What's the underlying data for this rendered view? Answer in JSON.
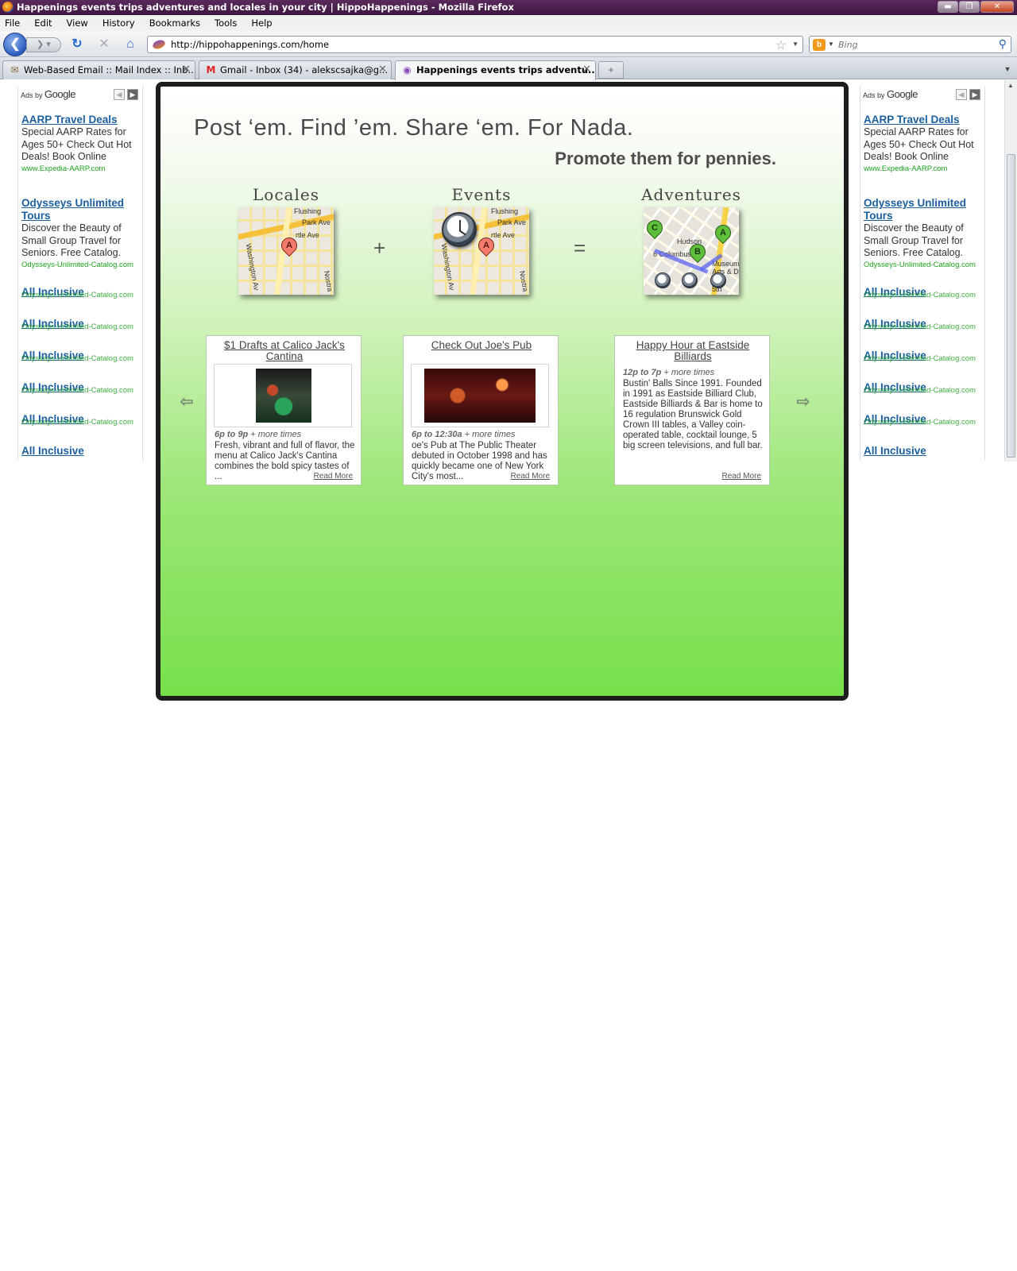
{
  "window": {
    "title": "Happenings events trips adventures and locales in your city | HippoHappenings - Mozilla Firefox",
    "minimize_label": "▬",
    "maximize_label": "❐",
    "close_label": "✕"
  },
  "menu": [
    "File",
    "Edit",
    "View",
    "History",
    "Bookmarks",
    "Tools",
    "Help"
  ],
  "navbar": {
    "back_label": "❮",
    "forward_label": "❯ ▾",
    "reload_label": "↻",
    "stop_label": "✕",
    "home_label": "⌂",
    "url": "http://hippohappenings.com/home",
    "search_placeholder": "Bing",
    "engine_label": "b"
  },
  "tabs": [
    {
      "label": "Web-Based Email :: Mail Index :: Inb...",
      "icon": "mail-client-icon",
      "active": false
    },
    {
      "label": "Gmail - Inbox (34) - alekscsajka@g...",
      "icon": "gmail-icon",
      "active": false
    },
    {
      "label": "Happenings events trips adventu...",
      "icon": "hippo-icon",
      "active": true
    }
  ],
  "ads": {
    "header_prefix": "Ads by",
    "header_brand": "Google",
    "items": [
      {
        "title": "AARP Travel Deals",
        "desc": "Special AARP Rates for Ages 50+ Check Out Hot Deals! Book Online",
        "url": "www.Expedia-AARP.com"
      },
      {
        "title": "Odysseys Unlimited Tours",
        "desc": "Discover the Beauty of Small Group Travel for Seniors. Free Catalog.",
        "url": "Odysseys-Unlimited-Catalog.com"
      }
    ],
    "stub_title": "All Inclusive",
    "stub_url": "Odysseys-Unlimited-Catalog.com"
  },
  "hero": {
    "headline": "Post ‘em. Find ’em. Share ‘em. For Nada.",
    "subheadline": "Promote them for pennies.",
    "concepts": [
      "Locales",
      "Events",
      "Adventures"
    ],
    "plus": "+",
    "equals": "=",
    "map_streets": {
      "flushing": "Flushing",
      "park": "Park Ave",
      "myrtle": "rtle Ave",
      "washington": "Washington Av",
      "nostrand": "Nostra",
      "hudson": "Hudson",
      "columbus": "6 Columbus",
      "museum": "Museum Arts & D",
      "fifth": "5th"
    },
    "pins": {
      "a": "A",
      "b": "B",
      "c": "C"
    }
  },
  "events": [
    {
      "title": "$1 Drafts at Calico Jack's Cantina",
      "time": "6p to 9p",
      "more": "+ more times",
      "desc": "Fresh, vibrant and full of flavor, the menu at Calico Jack's Cantina combines the bold spicy tastes of ...",
      "read_more": "Read More"
    },
    {
      "title": "Check Out Joe's Pub",
      "time": "6p to 12:30a",
      "more": "+ more times",
      "desc": "oe's Pub at The Public Theater debuted in October 1998 and has quickly became one of New York City's most...",
      "read_more": "Read More"
    },
    {
      "title": "Happy Hour at Eastside Billiards",
      "time": "12p to 7p",
      "more": "+ more times",
      "desc": "Bustin' Balls Since 1991. Founded in 1991 as Eastside Billiard Club, Eastside Billiards & Bar is home to 16 regulation Brunswick Gold Crown III tables, a Valley coin-operated table, cocktail lounge, 5 big screen televisions, and full bar.",
      "read_more": "Read More"
    }
  ],
  "carousel": {
    "prev_label": "⇦",
    "next_label": "⇨"
  },
  "colors": {
    "ad_title": "#1b5fa0",
    "ad_url": "#1da11d",
    "panel_border": "#1d1d1d",
    "panel_gradient_end": "#78e04a"
  }
}
